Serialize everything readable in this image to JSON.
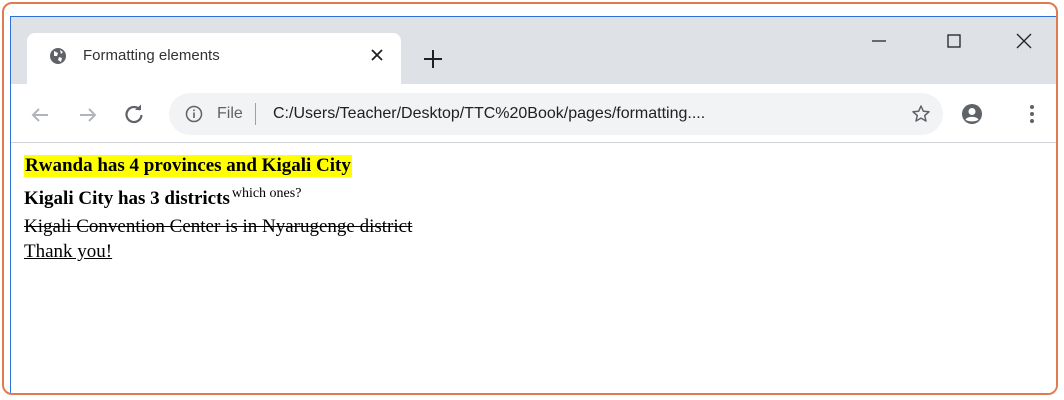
{
  "tab": {
    "title": "Formatting elements",
    "favicon": "globe-icon"
  },
  "window_controls": [
    "minimize-icon",
    "maximize-icon",
    "close-icon"
  ],
  "toolbar": {
    "scheme_label": "File",
    "url": "C:/Users/Teacher/Desktop/TTC%20Book/pages/formatting...."
  },
  "page": {
    "line1": "Rwanda has 4 provinces and Kigali City",
    "line2_main": "Kigali City has 3 districts",
    "line2_sup": "which ones?",
    "line3": "Kigali Convention Center is in Nyarugenge district",
    "line4": "Thank you!"
  },
  "colors": {
    "highlight": "#ffff00",
    "frame_accent": "#e07a4f",
    "window_border": "#2f6fd6",
    "titlebar": "#dee1e6"
  }
}
